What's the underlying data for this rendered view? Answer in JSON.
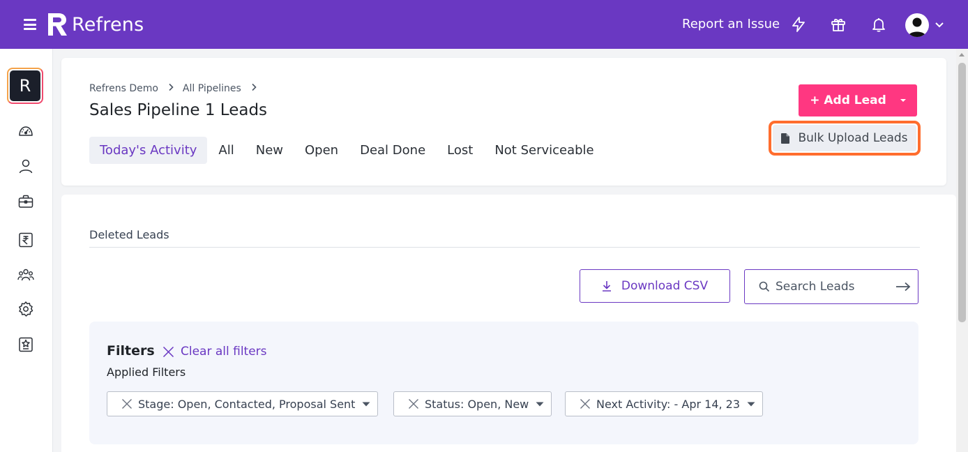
{
  "topbar": {
    "brand": "Refrens",
    "report_issue": "Report an Issue",
    "background_color": "#6a38c2",
    "icons": [
      "menu-icon",
      "lightning-icon",
      "gift-icon",
      "bell-icon",
      "user-avatar-icon",
      "chevron-down-icon"
    ]
  },
  "sidebar": {
    "org_initial": "R",
    "items": [
      "dashboard-icon",
      "user-icon",
      "briefcase-icon",
      "rupee-document-icon",
      "team-icon",
      "settings-icon",
      "star-badge-icon"
    ]
  },
  "header": {
    "breadcrumb": [
      "Refrens Demo",
      "All Pipelines"
    ],
    "title": "Sales Pipeline 1 Leads",
    "tabs": [
      {
        "label": "Today's Activity",
        "active": true
      },
      {
        "label": "All",
        "active": false
      },
      {
        "label": "New",
        "active": false
      },
      {
        "label": "Open",
        "active": false
      },
      {
        "label": "Deal Done",
        "active": false
      },
      {
        "label": "Lost",
        "active": false
      },
      {
        "label": "Not Serviceable",
        "active": false
      }
    ],
    "add_lead": "+ Add Lead",
    "bulk_upload": "Bulk Upload Leads",
    "accent_color": "#ff3781",
    "highlight_color": "#ff6d2e"
  },
  "content": {
    "deleted_leads": "Deleted Leads",
    "download_csv": "Download CSV",
    "search_placeholder": "Search Leads",
    "filters": {
      "title": "Filters",
      "clear_all": "Clear all filters",
      "applied_label": "Applied Filters",
      "chips": [
        "Stage: Open, Contacted, Proposal Sent",
        "Status: Open, New",
        "Next Activity: - Apr 14, 23"
      ]
    }
  }
}
